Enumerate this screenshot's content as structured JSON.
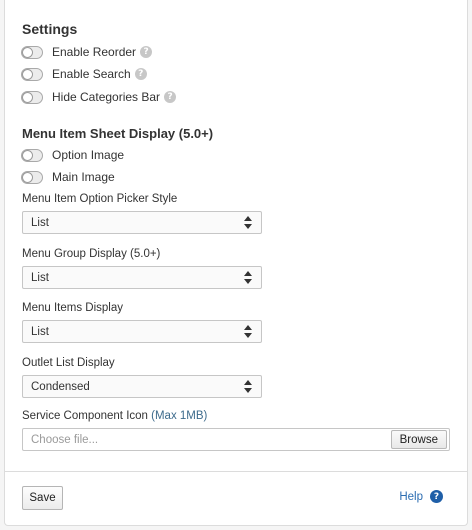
{
  "settings": {
    "title": "Settings",
    "toggles": [
      {
        "label": "Enable Reorder",
        "has_help": true,
        "on": false
      },
      {
        "label": "Enable Search",
        "has_help": true,
        "on": false
      },
      {
        "label": "Hide Categories Bar",
        "has_help": true,
        "on": false
      }
    ]
  },
  "menu_item_sheet": {
    "title": "Menu Item Sheet Display (5.0+)",
    "toggles": [
      {
        "label": "Option Image",
        "on": false
      },
      {
        "label": "Main Image",
        "on": false
      }
    ]
  },
  "fields": {
    "option_picker": {
      "label": "Menu Item Option Picker Style",
      "value": "List"
    },
    "group_display": {
      "label": "Menu Group Display (5.0+)",
      "value": "List"
    },
    "items_display": {
      "label": "Menu Items Display",
      "value": "List"
    },
    "outlet_display": {
      "label": "Outlet List Display",
      "value": "Condensed"
    }
  },
  "service_icon": {
    "label": "Service Component Icon",
    "hint": "(Max 1MB)",
    "placeholder": "Choose file...",
    "browse_label": "Browse"
  },
  "footer": {
    "save_label": "Save",
    "help_label": "Help"
  },
  "icons": {
    "help_small": "question-circle-icon",
    "help_link": "question-circle-icon"
  }
}
